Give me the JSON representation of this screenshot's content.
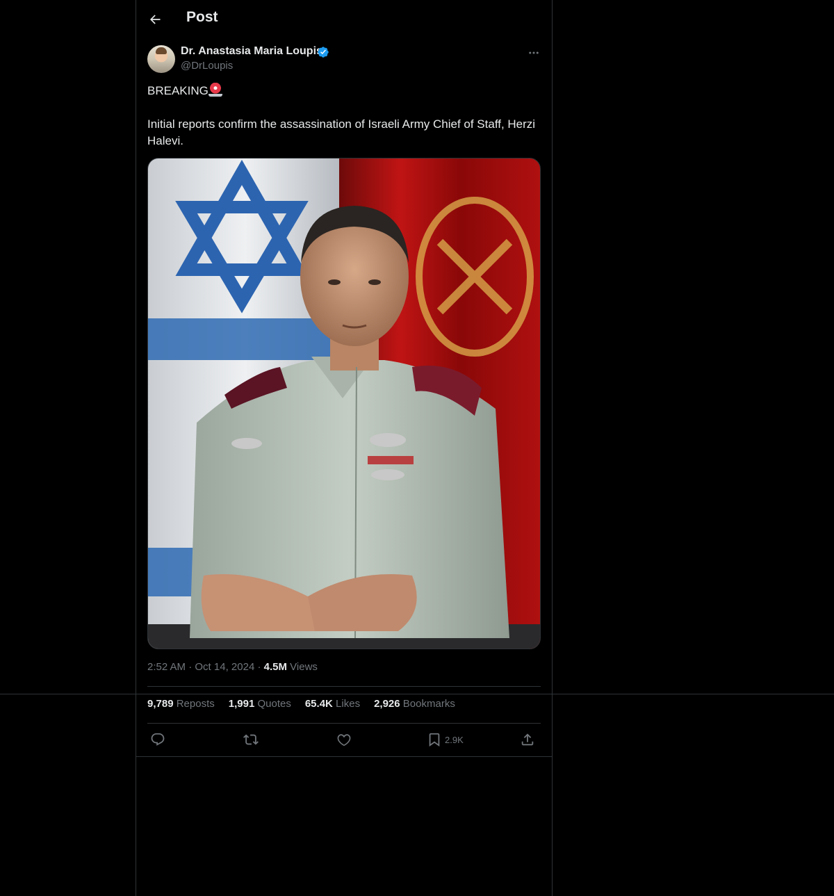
{
  "header": {
    "title": "Post"
  },
  "author": {
    "name": "Dr. Anastasia Maria Loupis",
    "handle": "@DrLoupis",
    "verified": true
  },
  "post": {
    "line1": "BREAKING",
    "line2": "Initial reports confirm the assassination of Israeli Army Chief of Staff, Herzi Halevi.",
    "time": "2:52 AM",
    "date": "Oct 14, 2024",
    "views_count": "4.5M",
    "views_label": "Views"
  },
  "stats": {
    "reposts_count": "9,789",
    "reposts_label": "Reposts",
    "quotes_count": "1,991",
    "quotes_label": "Quotes",
    "likes_count": "65.4K",
    "likes_label": "Likes",
    "bookmarks_count": "2,926",
    "bookmarks_label": "Bookmarks"
  },
  "actions": {
    "bookmark_count": "2.9K"
  },
  "icons": {
    "back": "arrow-left-icon",
    "verified": "verified-badge-icon",
    "more": "more-horizontal-icon",
    "reply": "reply-icon",
    "repost": "repost-icon",
    "like": "heart-icon",
    "bookmark": "bookmark-icon",
    "share": "share-icon",
    "siren": "siren-emoji-icon"
  },
  "colors": {
    "background": "#000000",
    "text": "#e7e9ea",
    "muted": "#71767b",
    "border": "#2f3336",
    "verified": "#1d9bf0"
  }
}
